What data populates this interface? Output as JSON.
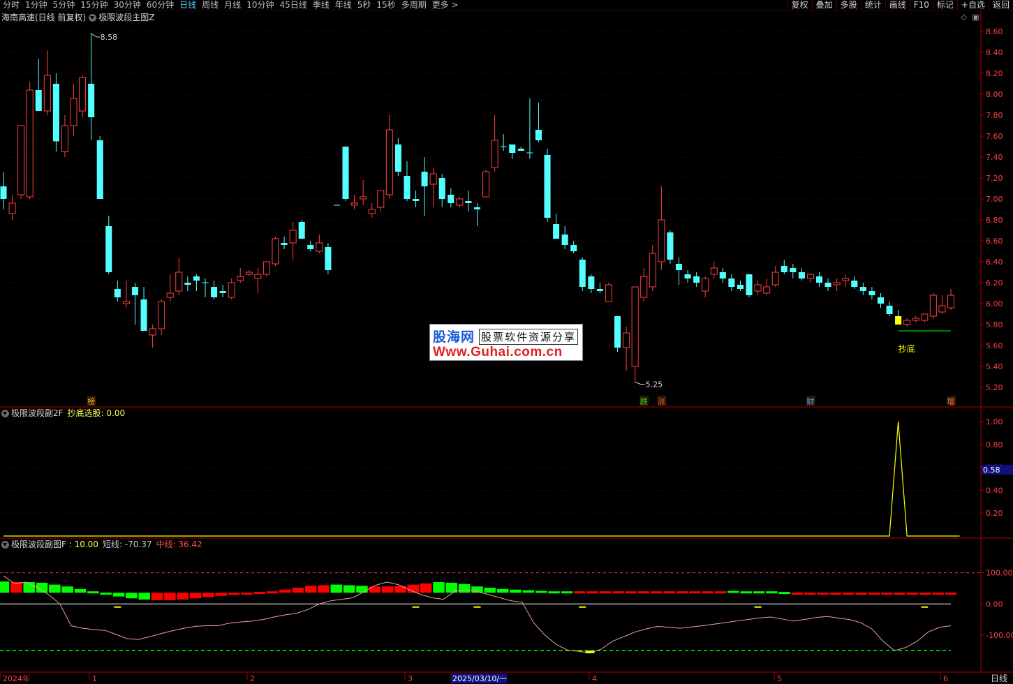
{
  "topbar": {
    "period_tabs": [
      "分时",
      "1分钟",
      "5分钟",
      "15分钟",
      "30分钟",
      "60分钟",
      "日线",
      "周线",
      "月线",
      "10分钟",
      "45日线",
      "季线",
      "年线",
      "5秒",
      "15秒",
      "多周期",
      "更多 >"
    ],
    "active_tab": "日线",
    "tool_tabs": [
      "复权",
      "叠加",
      "多股",
      "统计",
      "画线",
      "F10",
      "标记",
      "+自选",
      "返回"
    ]
  },
  "main_panel": {
    "stock_title": "海南高速(日线 前复权)",
    "indicator_name": "极限波段主图Z",
    "high_marker": "8.58",
    "low_marker": "5.25",
    "signal_label": "抄底",
    "event_markers": [
      {
        "text": "榜",
        "color": "#ffaa30"
      },
      {
        "text": "跌",
        "color": "#30d030"
      },
      {
        "text": "涨",
        "color": "#ff4040"
      },
      {
        "text": "财",
        "color": "#4aa0ff"
      },
      {
        "text": "增",
        "color": "#ff7040"
      }
    ],
    "y_labels": [
      "8.60",
      "8.40",
      "8.20",
      "8.00",
      "7.80",
      "7.60",
      "7.40",
      "7.20",
      "7.00",
      "6.80",
      "6.60",
      "6.40",
      "6.20",
      "6.00",
      "5.80",
      "5.60",
      "5.40",
      "5.20"
    ]
  },
  "sub_panel_1": {
    "indicator_name": "极限波段副2F",
    "field_label": "抄底选股",
    "field_value": "0.00",
    "y_labels": [
      "1.00",
      "0.80",
      "0.60",
      "0.40",
      "0.20"
    ],
    "current_value_tag": "0.58"
  },
  "sub_panel_2": {
    "indicator_name": "极限波段副图F",
    "field1_label": "",
    "field1_value": "10.00",
    "field2_label": "短线",
    "field2_value": "-70.37",
    "field3_label": "中线",
    "field3_value": "36.42",
    "y_labels": [
      "100.00",
      "0.00",
      "-100.00"
    ]
  },
  "x_axis": {
    "labels": [
      "2024年",
      "1",
      "2",
      "3",
      "2025/03/10/一",
      "4",
      "5",
      "6"
    ],
    "period_indicator": "日线"
  },
  "logo": {
    "brand_cn": "股海网",
    "slogan": "股票软件资源分享",
    "url": "Www.Guhai.com.cn"
  },
  "colors": {
    "up": "#ff4040",
    "down": "#54ffff",
    "grid": "#6a0000",
    "axis_text": "#ff4040",
    "signal_yellow": "#ffff00",
    "osc_green": "#00ff00",
    "osc_red": "#ff0000"
  },
  "chart_data": {
    "type": "candlestick",
    "title": "海南高速(日线 前复权)",
    "ylim": [
      5.1,
      8.7
    ],
    "candles": [
      [
        7.12,
        7.26,
        6.9,
        7.0
      ],
      [
        6.86,
        7.04,
        6.8,
        6.96
      ],
      [
        7.04,
        7.7,
        7.0,
        7.7
      ],
      [
        7.02,
        8.12,
        7.0,
        8.04
      ],
      [
        8.04,
        8.34,
        7.92,
        7.84
      ],
      [
        7.84,
        8.42,
        7.8,
        8.18
      ],
      [
        8.1,
        8.2,
        7.45,
        7.55
      ],
      [
        7.45,
        7.8,
        7.4,
        7.7
      ],
      [
        7.7,
        8.1,
        7.6,
        7.96
      ],
      [
        7.84,
        8.18,
        7.78,
        8.16
      ],
      [
        8.1,
        8.58,
        7.56,
        7.78
      ],
      [
        7.56,
        7.6,
        7.0,
        7.0
      ],
      [
        6.74,
        6.84,
        6.28,
        6.3
      ],
      [
        6.14,
        6.22,
        6.02,
        6.06
      ],
      [
        6.0,
        6.22,
        5.96,
        6.02
      ],
      [
        6.16,
        6.2,
        5.8,
        6.08
      ],
      [
        6.04,
        6.16,
        5.76,
        5.74
      ],
      [
        5.7,
        5.8,
        5.58,
        5.76
      ],
      [
        5.76,
        6.04,
        5.7,
        6.02
      ],
      [
        6.06,
        6.28,
        6.02,
        6.1
      ],
      [
        6.12,
        6.44,
        6.08,
        6.3
      ],
      [
        6.2,
        6.26,
        6.12,
        6.18
      ],
      [
        6.26,
        6.28,
        6.12,
        6.22
      ],
      [
        6.2,
        6.24,
        6.06,
        6.2
      ],
      [
        6.16,
        6.22,
        6.04,
        6.06
      ],
      [
        6.12,
        6.18,
        6.06,
        6.1
      ],
      [
        6.06,
        6.24,
        6.04,
        6.2
      ],
      [
        6.22,
        6.34,
        6.2,
        6.26
      ],
      [
        6.28,
        6.32,
        6.26,
        6.3
      ],
      [
        6.24,
        6.34,
        6.1,
        6.28
      ],
      [
        6.28,
        6.4,
        6.26,
        6.4
      ],
      [
        6.38,
        6.64,
        6.36,
        6.62
      ],
      [
        6.58,
        6.64,
        6.52,
        6.56
      ],
      [
        6.58,
        6.78,
        6.42,
        6.7
      ],
      [
        6.78,
        6.8,
        6.64,
        6.62
      ],
      [
        6.56,
        6.6,
        6.5,
        6.52
      ],
      [
        6.5,
        6.66,
        6.48,
        6.58
      ],
      [
        6.54,
        6.58,
        6.28,
        6.32
      ],
      [
        6.94,
        6.94,
        6.94,
        6.94
      ],
      [
        7.5,
        7.5,
        6.98,
        7.0
      ],
      [
        6.94,
        7.04,
        6.9,
        6.96
      ],
      [
        7.0,
        7.18,
        6.94,
        7.02
      ],
      [
        6.86,
        6.96,
        6.82,
        6.9
      ],
      [
        6.92,
        7.08,
        6.88,
        7.08
      ],
      [
        7.04,
        7.8,
        7.0,
        7.66
      ],
      [
        7.52,
        7.58,
        7.22,
        7.26
      ],
      [
        7.22,
        7.36,
        6.98,
        7.0
      ],
      [
        7.0,
        7.08,
        6.92,
        6.98
      ],
      [
        7.26,
        7.4,
        6.84,
        7.12
      ],
      [
        7.14,
        7.3,
        6.92,
        7.24
      ],
      [
        7.2,
        7.24,
        6.92,
        7.0
      ],
      [
        7.04,
        7.1,
        6.92,
        6.96
      ],
      [
        6.94,
        7.02,
        6.92,
        7.0
      ],
      [
        6.98,
        7.08,
        6.88,
        6.96
      ],
      [
        6.92,
        6.96,
        6.74,
        6.9
      ],
      [
        7.02,
        7.28,
        7.02,
        7.26
      ],
      [
        7.3,
        7.8,
        7.26,
        7.56
      ],
      [
        7.5,
        7.62,
        7.46,
        7.5
      ],
      [
        7.52,
        7.52,
        7.38,
        7.44
      ],
      [
        7.48,
        7.5,
        7.46,
        7.46
      ],
      [
        7.44,
        7.96,
        7.38,
        7.44
      ],
      [
        7.66,
        7.92,
        7.54,
        7.56
      ],
      [
        7.42,
        7.48,
        6.78,
        6.82
      ],
      [
        6.76,
        6.86,
        6.62,
        6.62
      ],
      [
        6.66,
        6.74,
        6.52,
        6.56
      ],
      [
        6.56,
        6.6,
        6.48,
        6.5
      ],
      [
        6.42,
        6.44,
        6.12,
        6.16
      ],
      [
        6.26,
        6.28,
        6.1,
        6.14
      ],
      [
        6.14,
        6.2,
        6.1,
        6.12
      ],
      [
        6.02,
        6.2,
        6.02,
        6.18
      ],
      [
        5.88,
        5.88,
        5.54,
        5.58
      ],
      [
        5.58,
        5.78,
        5.36,
        5.72
      ],
      [
        5.4,
        6.16,
        5.25,
        6.16
      ],
      [
        6.06,
        6.34,
        6.02,
        6.26
      ],
      [
        6.16,
        6.56,
        6.12,
        6.48
      ],
      [
        6.4,
        7.12,
        6.32,
        6.8
      ],
      [
        6.68,
        6.7,
        6.38,
        6.42
      ],
      [
        6.38,
        6.44,
        6.18,
        6.32
      ],
      [
        6.28,
        6.32,
        6.2,
        6.24
      ],
      [
        6.26,
        6.3,
        6.16,
        6.2
      ],
      [
        6.12,
        6.26,
        6.06,
        6.24
      ],
      [
        6.28,
        6.4,
        6.24,
        6.34
      ],
      [
        6.3,
        6.34,
        6.2,
        6.24
      ],
      [
        6.24,
        6.28,
        6.12,
        6.16
      ],
      [
        6.18,
        6.22,
        6.12,
        6.14
      ],
      [
        6.28,
        6.28,
        6.06,
        6.08
      ],
      [
        6.12,
        6.22,
        6.08,
        6.18
      ],
      [
        6.1,
        6.24,
        6.08,
        6.16
      ],
      [
        6.18,
        6.36,
        6.16,
        6.3
      ],
      [
        6.36,
        6.42,
        6.28,
        6.3
      ],
      [
        6.34,
        6.38,
        6.24,
        6.3
      ],
      [
        6.3,
        6.34,
        6.22,
        6.24
      ],
      [
        6.24,
        6.28,
        6.2,
        6.28
      ],
      [
        6.26,
        6.3,
        6.16,
        6.2
      ],
      [
        6.2,
        6.24,
        6.12,
        6.16
      ],
      [
        6.18,
        6.24,
        6.12,
        6.2
      ],
      [
        6.22,
        6.28,
        6.16,
        6.24
      ],
      [
        6.22,
        6.26,
        6.14,
        6.16
      ],
      [
        6.16,
        6.2,
        6.08,
        6.12
      ],
      [
        6.12,
        6.16,
        6.04,
        6.08
      ],
      [
        6.06,
        6.1,
        5.96,
        6.0
      ],
      [
        5.98,
        6.02,
        5.88,
        5.9
      ],
      [
        5.88,
        5.94,
        5.8,
        5.8
      ],
      [
        5.8,
        5.86,
        5.78,
        5.84
      ],
      [
        5.84,
        5.88,
        5.82,
        5.86
      ],
      [
        5.84,
        5.9,
        5.82,
        5.9
      ],
      [
        5.88,
        6.1,
        5.86,
        6.08
      ],
      [
        5.92,
        6.08,
        5.9,
        5.98
      ],
      [
        5.96,
        6.14,
        5.94,
        6.08
      ]
    ],
    "signal_series": [
      0,
      0,
      0,
      0,
      0,
      0,
      0,
      0,
      0,
      0,
      0,
      0,
      0,
      0,
      0,
      0,
      0,
      0,
      0,
      0,
      0,
      0,
      0,
      0,
      0,
      0,
      0,
      0,
      0,
      0,
      0,
      0,
      0,
      0,
      0,
      0,
      0,
      0,
      0,
      0,
      0,
      0,
      0,
      0,
      0,
      0,
      0,
      0,
      0,
      0,
      0,
      0,
      0,
      0,
      0,
      0,
      0,
      0,
      0,
      0,
      0,
      0,
      0,
      0,
      0,
      0,
      0,
      0,
      0,
      0,
      0,
      0,
      0,
      0,
      0,
      0,
      0,
      0,
      0,
      0,
      0,
      0,
      0,
      0,
      0,
      0,
      0,
      0,
      0,
      0,
      0,
      0,
      0,
      0,
      0,
      0,
      0,
      0,
      0,
      0,
      0,
      0,
      1,
      0,
      0,
      0,
      0,
      0,
      0,
      0
    ],
    "short_line": [
      90,
      65,
      70,
      52,
      30,
      0,
      -70,
      -78,
      -82,
      -85,
      -98,
      -112,
      -114,
      -105,
      -95,
      -86,
      -78,
      -72,
      -70,
      -70,
      -62,
      -58,
      -55,
      -50,
      -42,
      -35,
      -30,
      -18,
      0,
      10,
      15,
      20,
      40,
      60,
      70,
      62,
      45,
      30,
      20,
      15,
      40,
      45,
      40,
      30,
      20,
      10,
      5,
      -60,
      -100,
      -130,
      -148,
      -152,
      -158,
      -145,
      -120,
      -105,
      -90,
      -80,
      -72,
      -75,
      -78,
      -74,
      -70,
      -65,
      -60,
      -55,
      -50,
      -45,
      -42,
      -48,
      -55,
      -50,
      -44,
      -40,
      -45,
      -50,
      -60,
      -80,
      -120,
      -150,
      -140,
      -120,
      -90,
      -75,
      -70
    ],
    "mid_line": [
      72,
      70,
      70,
      68,
      62,
      56,
      48,
      40,
      32,
      24,
      18,
      14,
      12,
      12,
      14,
      18,
      22,
      26,
      30,
      32,
      34,
      40,
      46,
      52,
      58,
      60,
      62,
      60,
      58,
      56,
      56,
      58,
      62,
      66,
      70,
      68,
      64,
      56,
      52,
      48,
      46,
      44,
      42,
      40,
      38,
      36,
      36,
      36,
      36,
      36,
      36,
      36,
      36,
      36,
      36,
      38,
      40,
      42,
      40,
      38,
      36,
      34,
      32,
      32,
      32,
      32,
      32,
      32,
      32,
      32,
      32,
      32,
      32,
      32,
      32
    ]
  }
}
